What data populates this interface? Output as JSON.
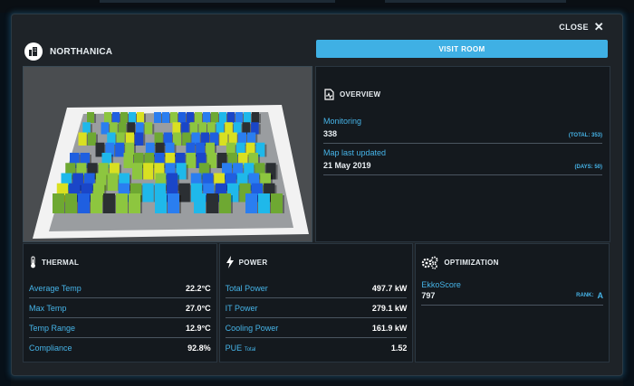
{
  "modal": {
    "close_label": "CLOSE",
    "site_name": "NORTHANICA",
    "visit_button": "VISIT ROOM"
  },
  "overview": {
    "title": "OVERVIEW",
    "monitoring_label": "Monitoring",
    "monitoring_value": "338",
    "monitoring_total": "(TOTAL: 353)",
    "updated_label": "Map last updated",
    "updated_value": "21 May 2019",
    "updated_days": "(DAYS: 50)"
  },
  "thermal": {
    "title": "THERMAL",
    "rows": [
      {
        "label": "Average Temp",
        "value": "22.2°C"
      },
      {
        "label": "Max Temp",
        "value": "27.0°C"
      },
      {
        "label": "Temp Range",
        "value": "12.9°C"
      },
      {
        "label": "Compliance",
        "value": "92.8%"
      }
    ]
  },
  "power": {
    "title": "POWER",
    "rows": [
      {
        "label": "Total Power",
        "value": "497.7 kW"
      },
      {
        "label": "IT Power",
        "value": "279.1 kW"
      },
      {
        "label": "Cooling Power",
        "value": "161.9 kW"
      }
    ],
    "pue_label": "PUE",
    "pue_sub": "Total",
    "pue_value": "1.52"
  },
  "optimization": {
    "title": "OPTIMIZATION",
    "score_label": "EkkoScore",
    "score_value": "797",
    "rank_label": "RANK:",
    "rank_value": "A"
  },
  "icons": {
    "close": "close-icon",
    "site": "building-icon",
    "overview": "document-pulse-icon",
    "thermal": "thermometer-icon",
    "power": "lightning-icon",
    "optimization": "gears-icon"
  },
  "colors": {
    "accent": "#3fb0e4",
    "label_blue": "#46b4e8",
    "panel": "#14191e",
    "modal": "#1e2328"
  }
}
